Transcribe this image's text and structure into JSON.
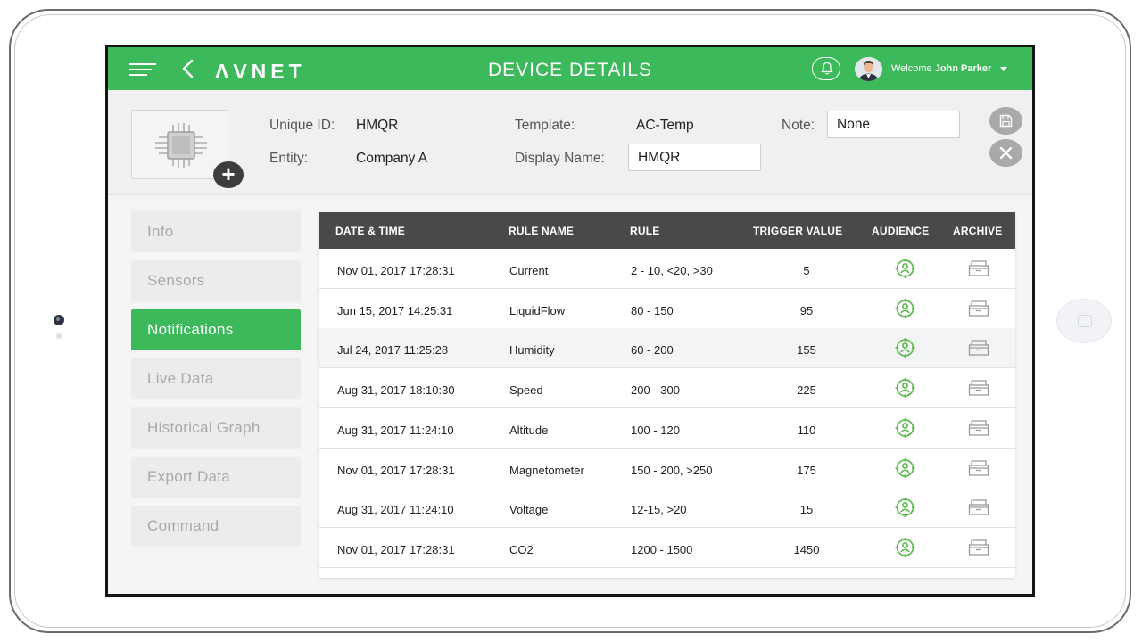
{
  "header": {
    "logo": "ΛVNET",
    "title": "DEVICE DETAILS",
    "welcome_prefix": "Welcome",
    "user_name": "John Parker"
  },
  "device": {
    "unique_id_label": "Unique ID:",
    "unique_id": "HMQR",
    "entity_label": "Entity:",
    "entity": "Company A",
    "template_label": "Template:",
    "template": "AC-Temp",
    "display_name_label": "Display Name:",
    "display_name": "HMQR",
    "note_label": "Note:",
    "note": "None"
  },
  "sidebar": {
    "items": [
      {
        "label": "Info"
      },
      {
        "label": "Sensors"
      },
      {
        "label": "Notifications"
      },
      {
        "label": "Live Data"
      },
      {
        "label": "Historical Graph"
      },
      {
        "label": "Export Data"
      },
      {
        "label": "Command"
      }
    ],
    "active": "Notifications"
  },
  "table": {
    "columns": [
      "DATE & TIME",
      "RULE NAME",
      "RULE",
      "TRIGGER VALUE",
      "AUDIENCE",
      "ARCHIVE"
    ],
    "rows": [
      {
        "datetime": "Nov 01, 2017 17:28:31",
        "rule_name": "Current",
        "rule": "2 - 10, <20, >30",
        "trigger": "5"
      },
      {
        "datetime": "Jun 15, 2017 14:25:31",
        "rule_name": "LiquidFlow",
        "rule": "80 - 150",
        "trigger": "95"
      },
      {
        "datetime": "Jul 24, 2017 11:25:28",
        "rule_name": "Humidity",
        "rule": "60 - 200",
        "trigger": "155"
      },
      {
        "datetime": "Aug 31, 2017 18:10:30",
        "rule_name": "Speed",
        "rule": "200 - 300",
        "trigger": "225"
      },
      {
        "datetime": "Aug 31, 2017 11:24:10",
        "rule_name": "Altitude",
        "rule": "100 - 120",
        "trigger": "110"
      },
      {
        "datetime": "Nov 01, 2017 17:28:31",
        "rule_name": "Magnetometer",
        "rule": "150 - 200, >250",
        "trigger": "175"
      },
      {
        "datetime": "Aug 31, 2017 11:24:10",
        "rule_name": "Voltage",
        "rule": "12-15, >20",
        "trigger": "15"
      },
      {
        "datetime": "Nov 01, 2017 17:28:31",
        "rule_name": "CO2",
        "rule": "1200 - 1500",
        "trigger": "1450"
      }
    ]
  },
  "icons": {
    "menu": "hamburger-icon",
    "back": "back-chevron-icon",
    "bell": "bell-icon",
    "chip": "chip-icon",
    "add": "plus-icon",
    "save": "save-icon",
    "close": "close-icon",
    "audience": "audience-icon",
    "archive": "archive-icon"
  },
  "colors": {
    "brand_green": "#3cba5b",
    "table_header": "#494949",
    "audience_icon": "#56b848"
  }
}
